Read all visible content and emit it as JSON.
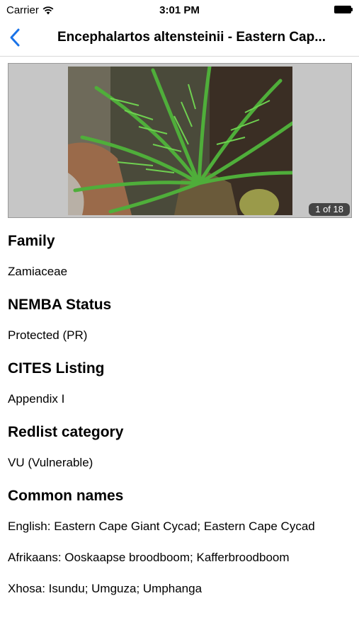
{
  "status_bar": {
    "carrier": "Carrier",
    "time": "3:01 PM"
  },
  "nav": {
    "title": "Encephalartos altensteinii - Eastern Cap..."
  },
  "gallery": {
    "counter": "1 of 18"
  },
  "sections": [
    {
      "heading": "Family",
      "values": [
        "Zamiaceae"
      ]
    },
    {
      "heading": "NEMBA Status",
      "values": [
        "Protected (PR)"
      ]
    },
    {
      "heading": "CITES Listing",
      "values": [
        "Appendix I"
      ]
    },
    {
      "heading": "Redlist category",
      "values": [
        "VU (Vulnerable)"
      ]
    },
    {
      "heading": "Common names",
      "values": [
        "English: Eastern Cape Giant Cycad; Eastern Cape Cycad",
        "Afrikaans: Ooskaapse broodboom; Kafferbroodboom",
        "Xhosa: Isundu; Umguza; Umphanga"
      ]
    }
  ],
  "colors": {
    "accent": "#1a73e8"
  }
}
